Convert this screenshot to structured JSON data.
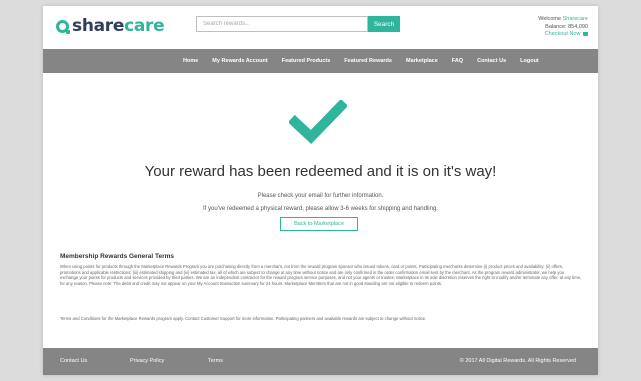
{
  "header": {
    "logo_share": "share",
    "logo_care": "care",
    "search_placeholder": "Search rewards...",
    "search_button": "Search",
    "welcome_label": "Welcome",
    "welcome_user": "Sharecare",
    "balance_label": "Balance:",
    "balance_value": "854,090",
    "checkout_label": "Checkout Now",
    "cart_icon": "cart-icon"
  },
  "nav": {
    "items": [
      "Home",
      "My Rewards Account",
      "Featured Products",
      "Featured Rewards",
      "Marketplace",
      "FAQ",
      "Contact Us",
      "Logout"
    ]
  },
  "main": {
    "check_icon": "checkmark-icon",
    "title": "Your reward has been redeemed and it is on it's way!",
    "info_line_1": "Please check your email for further information.",
    "info_line_2": "If you've redeemed a physical reward, please allow 3-6 weeks for shipping and handling.",
    "back_button": "Back to Marketplace"
  },
  "terms": {
    "heading": "Membership Rewards General Terms",
    "body": "When using points for products through the Marketplace Rewards Program you are purchasing directly from a merchant, not from the reward program sponsor who issued tokens, card or points. Participating merchants determine (i) product prices and availability; (ii) offers, promotions and applicable restrictions; (iii) estimated shipping and (iv) estimated tax, all of which are subject to change at any time without notice and are only confirmed in the order confirmation email sent by the merchant. As the program reward administrator, we help you exchange your points for products and services provided by third parties. We are an independent contractor for the reward program service purposes, and not your agents or trustee. Marketplace in its sole discretion reserves the right to modify and/or terminate any offer, at any time, for any reason. Please note: The debit and credit may not appear on your My Account transaction summary for 24 hours. Marketplace Members that are not in good standing are not eligible to redeem points.",
    "note": "Terms and Conditions for the Marketplace Rewards program apply. Contact Customer Support for more information. Participating partners and available rewards are subject to change without notice."
  },
  "footer": {
    "links": [
      "Contact Us",
      "Privacy Policy",
      "Terms"
    ],
    "copyright": "© 2017 All Digital Rewards. All Rights Reserved"
  },
  "colors": {
    "accent": "#2fb59c",
    "nav_bg": "#858585",
    "logo_dark": "#2f3e5c"
  }
}
